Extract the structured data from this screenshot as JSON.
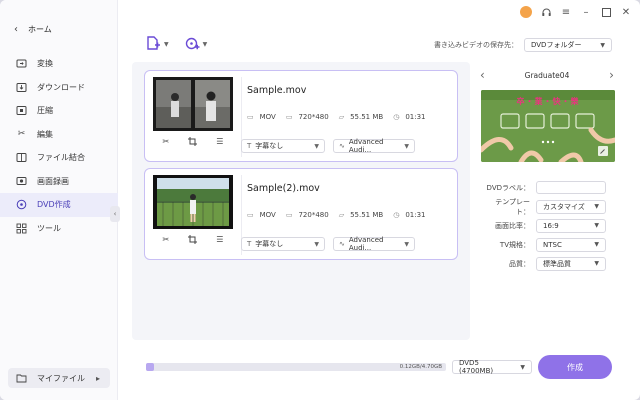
{
  "sidebar": {
    "home_label": "ホーム",
    "items": [
      {
        "label": "変換",
        "icon": "convert-icon"
      },
      {
        "label": "ダウンロード",
        "icon": "download-icon"
      },
      {
        "label": "圧縮",
        "icon": "compress-icon"
      },
      {
        "label": "編集",
        "icon": "scissors-icon"
      },
      {
        "label": "ファイル結合",
        "icon": "merge-icon"
      },
      {
        "label": "画面録画",
        "icon": "screen-record-icon"
      },
      {
        "label": "DVD作成",
        "icon": "dvd-icon",
        "active": true
      },
      {
        "label": "ツール",
        "icon": "tools-grid-icon"
      }
    ],
    "my_files_label": "マイファイル"
  },
  "toolbar": {
    "save_location_label": "書き込みビデオの保存先：",
    "save_location_value": "DVDフォルダー"
  },
  "files": [
    {
      "title": "Sample.mov",
      "format": "MOV",
      "resolution": "720*480",
      "size": "55.51 MB",
      "duration": "01:31",
      "subtitle": "字幕なし",
      "audio": "Advanced Audi..."
    },
    {
      "title": "Sample(2).mov",
      "format": "MOV",
      "resolution": "720*480",
      "size": "55.51 MB",
      "duration": "01:31",
      "subtitle": "字幕なし",
      "audio": "Advanced Audi..."
    }
  ],
  "template_panel": {
    "template_name": "Graduate04",
    "preview_text": "卒・業・快・樂",
    "preview_page_dots": 3
  },
  "settings": {
    "dvd_label_label": "DVDラベル：",
    "dvd_label_value": "",
    "template_label": "テンプレート：",
    "template_value": "カスタマイズ",
    "aspect_label": "画面比率：",
    "aspect_value": "16:9",
    "tv_label": "TV規格：",
    "tv_value": "NTSC",
    "quality_label": "品質：",
    "quality_value": "標準品質"
  },
  "bottom": {
    "capacity_text": "0.12GB/4.70GB",
    "capacity_fraction": 0.026,
    "disc_type": "DVD5 (4700MB)",
    "burn_label": "作成"
  },
  "colors": {
    "accent": "#8f72e8",
    "active_bg": "#ececfa",
    "card_border": "#c8bff4",
    "avatar": "#f4a34a"
  }
}
